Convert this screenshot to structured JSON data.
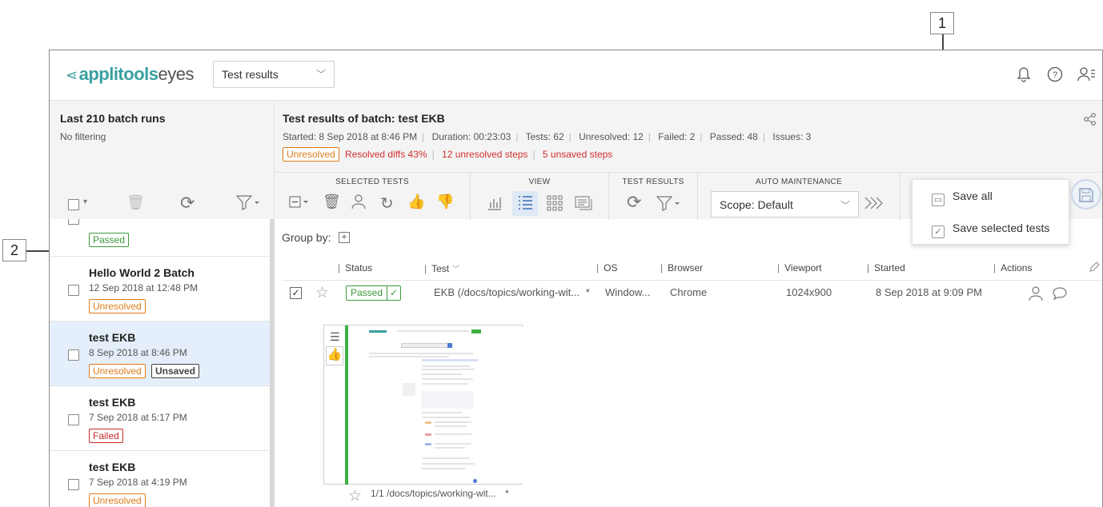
{
  "callouts": {
    "one": "1",
    "two": "2"
  },
  "header": {
    "logo_brand": "applitools",
    "logo_product": "eyes",
    "view_select": "Test results"
  },
  "left": {
    "title": "Last 210 batch runs",
    "subtitle": "No filtering",
    "batches": [
      {
        "name": "",
        "date": "",
        "tags": [
          "Passed"
        ]
      },
      {
        "name": "Hello World 2 Batch",
        "date": "12 Sep 2018 at 12:48 PM",
        "tags": [
          "Unresolved"
        ]
      },
      {
        "name": "test EKB",
        "date": "8 Sep 2018 at 8:46 PM",
        "tags": [
          "Unresolved",
          "Unsaved"
        ]
      },
      {
        "name": "test EKB",
        "date": "7 Sep 2018 at 5:17 PM",
        "tags": [
          "Failed"
        ]
      },
      {
        "name": "test EKB",
        "date": "7 Sep 2018 at 4:19 PM",
        "tags": [
          "Unresolved"
        ]
      }
    ]
  },
  "batch": {
    "title": "Test results of batch: test EKB",
    "stats": [
      "Started: 8 Sep 2018 at 8:46 PM",
      "Duration: 00:23:03",
      "Tests: 62",
      "Unresolved: 12",
      "Failed: 2",
      "Passed: 48",
      "Issues: 3"
    ],
    "status_tag": "Unresolved",
    "flags": [
      "Resolved diffs 43%",
      "12 unresolved steps",
      "5 unsaved steps"
    ]
  },
  "toolbar": {
    "selected_tests": "SELECTED TESTS",
    "view": "VIEW",
    "test_results": "TEST RESULTS",
    "auto_maintenance": "AUTO MAINTENANCE",
    "scope": "Scope: Default"
  },
  "save_menu": {
    "save_all": "Save all",
    "save_selected": "Save selected tests"
  },
  "content": {
    "group_by": "Group by:",
    "columns": [
      "Status",
      "Test",
      "OS",
      "Browser",
      "Viewport",
      "Started",
      "Actions"
    ],
    "row": {
      "status": "Passed",
      "test": "EKB (/docs/topics/working-wit...",
      "test_mark": "*",
      "os": "Window...",
      "browser": "Chrome",
      "viewport": "1024x900",
      "started": "8 Sep 2018 at 9:09 PM"
    },
    "thumb_caption": "1/1 /docs/topics/working-wit...",
    "thumb_mark": "*"
  }
}
